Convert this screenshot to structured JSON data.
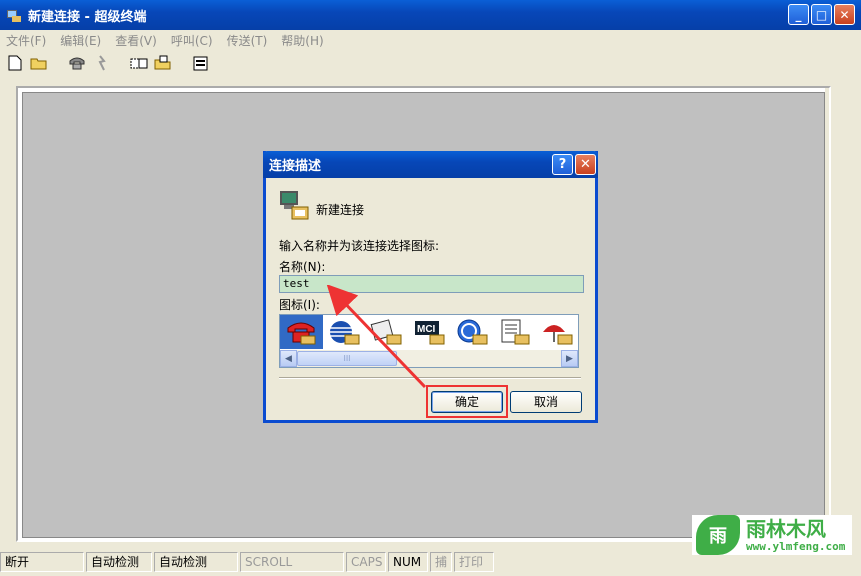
{
  "window": {
    "title": "新建连接 - 超级终端"
  },
  "menu": [
    "文件(F)",
    "编辑(E)",
    "查看(V)",
    "呼叫(C)",
    "传送(T)",
    "帮助(H)"
  ],
  "dialog": {
    "title": "连接描述",
    "connection_name": "新建连接",
    "prompt": "输入名称并为该连接选择图标:",
    "name_label": "名称(N):",
    "name_value": "test",
    "icon_label": "图标(I):",
    "ok_label": "确定",
    "cancel_label": "取消",
    "help_glyph": "?",
    "close_glyph": "✕"
  },
  "icons": [
    {
      "name": "phone-icon",
      "selected": true
    },
    {
      "name": "globe-phone-icon",
      "selected": false
    },
    {
      "name": "tape-phone-icon",
      "selected": false
    },
    {
      "name": "mci-phone-icon",
      "selected": false,
      "text": "MCI"
    },
    {
      "name": "ge-phone-icon",
      "selected": false
    },
    {
      "name": "doc-phone-icon",
      "selected": false
    },
    {
      "name": "umbrella-phone-icon",
      "selected": false
    }
  ],
  "scroll": {
    "thumb": "III"
  },
  "status": {
    "cells": [
      {
        "label": "断开",
        "enabled": true
      },
      {
        "label": "自动检测",
        "enabled": true
      },
      {
        "label": "自动检测",
        "enabled": true
      },
      {
        "label": "SCROLL",
        "enabled": false
      },
      {
        "label": "CAPS",
        "enabled": false
      },
      {
        "label": "NUM",
        "enabled": true
      },
      {
        "label": "捕",
        "enabled": false
      },
      {
        "label": "打印",
        "enabled": false
      }
    ]
  },
  "watermark": {
    "logo_text": "雨",
    "brand": "雨林木风",
    "url": "www.ylmfeng.com"
  },
  "colors": {
    "title_blue": "#0747b8",
    "highlight_red": "#e33",
    "input_bg": "#c8e6c9",
    "brand_green": "#3fae47"
  }
}
